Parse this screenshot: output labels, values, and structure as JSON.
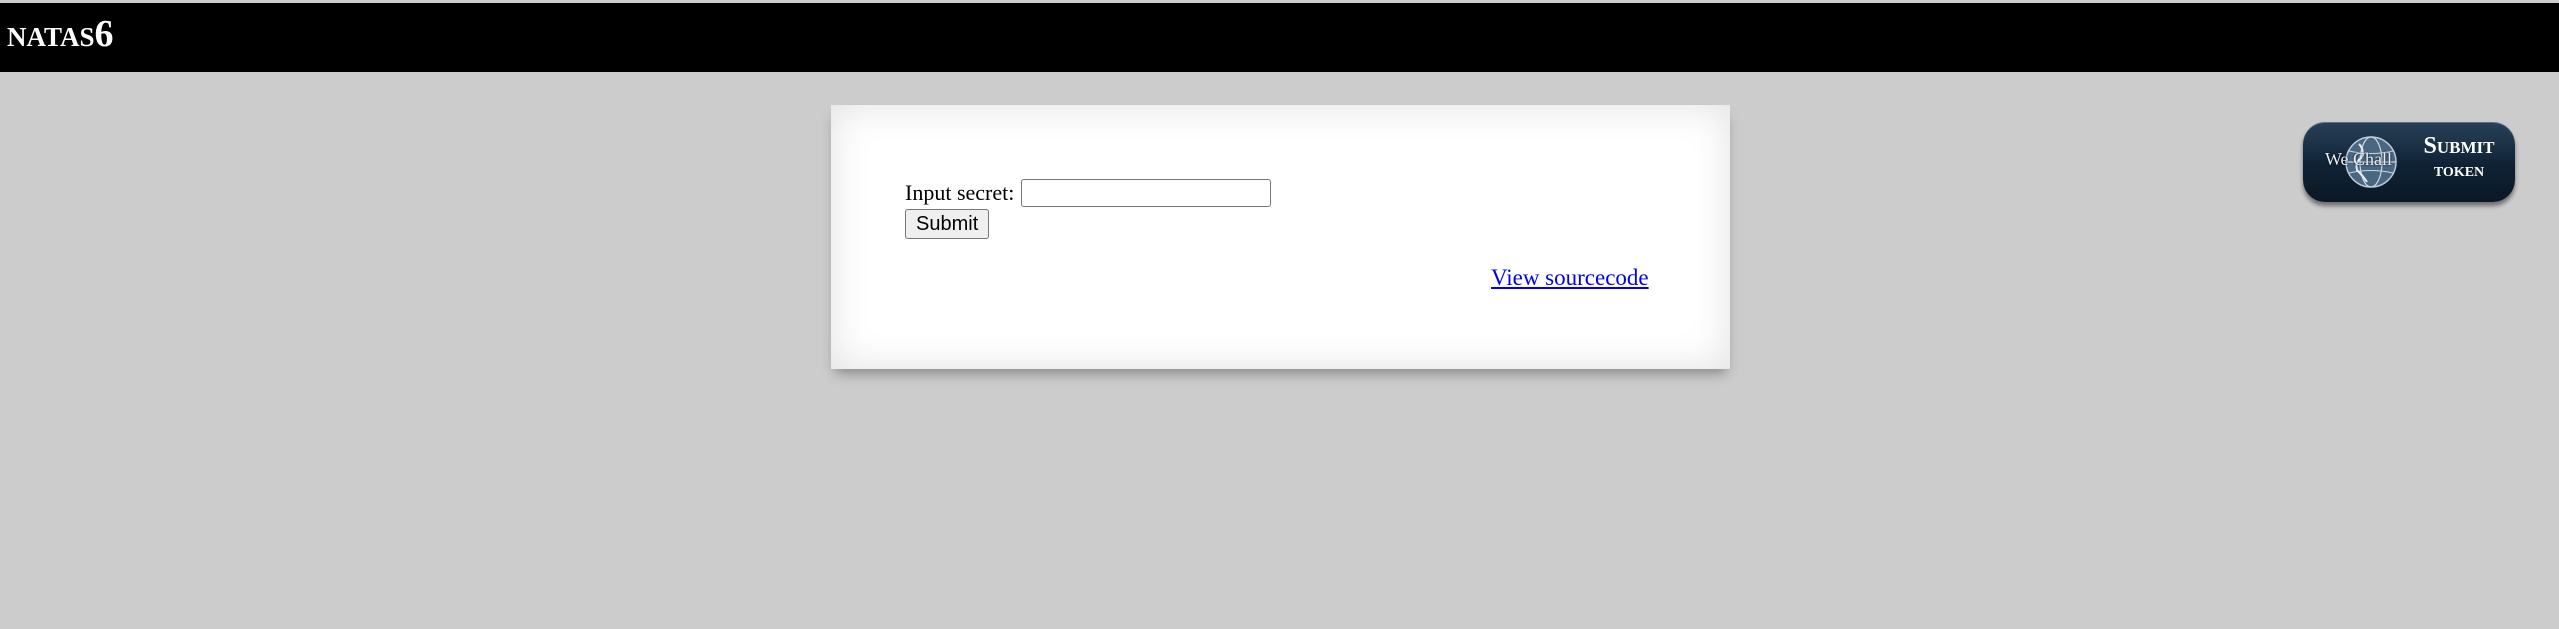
{
  "header": {
    "title": "natas6"
  },
  "form": {
    "label": "Input secret:",
    "input_value": "",
    "submit_label": "Submit"
  },
  "links": {
    "view_source": "View sourcecode"
  },
  "wechall": {
    "logo_text": "We Chall",
    "line1": "Submit",
    "line2": "token"
  }
}
